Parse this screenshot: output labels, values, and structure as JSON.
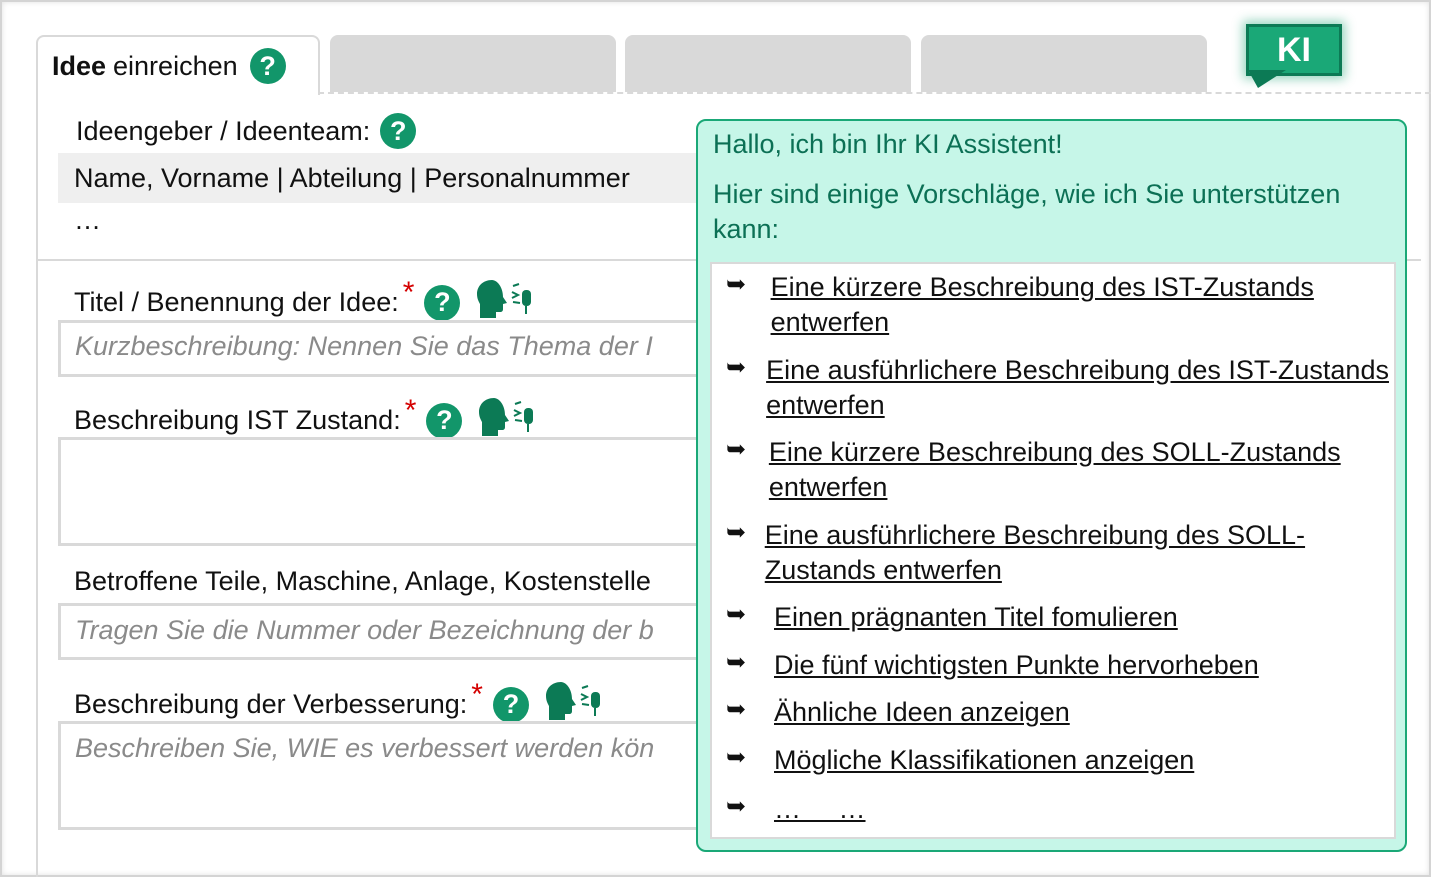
{
  "tabs": {
    "active_bold": "Idee",
    "active_rest": "einreichen",
    "inactive": [
      "",
      "",
      ""
    ]
  },
  "ki_badge": "KI",
  "form": {
    "ideengeber_label": "Ideengeber / Ideenteam:",
    "ideengeber_value": "Name, Vorname | Abteilung | Personalnummer",
    "ideengeber_more": "…",
    "titel_label": "Titel / Benennung der Idee:",
    "titel_placeholder": "Kurzbeschreibung: Nennen Sie das Thema der I",
    "ist_label": "Beschreibung IST Zustand:",
    "teile_label": "Betroffene Teile, Maschine, Anlage, Kostenstelle",
    "teile_placeholder": "Tragen Sie die Nummer oder Bezeichnung der b",
    "verbesserung_label": "Beschreibung der Verbesserung:",
    "verbesserung_placeholder": "Beschreiben Sie, WIE es verbessert werden kön",
    "required_mark": "*",
    "help_glyph": "?"
  },
  "assistant": {
    "greeting": "Hallo, ich bin Ihr KI Assistent!",
    "intro": "Hier sind einige Vorschläge, wie ich Sie unterstützen kann:",
    "bullet": "➥",
    "suggestions": [
      "Eine kürzere Beschreibung des IST-Zustands entwerfen",
      "Eine ausführlichere Beschreibung des IST-Zustands entwerfen",
      "Eine kürzere Beschreibung des SOLL-Zustands entwerfen",
      "Eine ausführlichere Beschreibung des SOLL-Zustands entwerfen",
      "Einen prägnanten Titel fomulieren",
      "Die fünf wichtigsten Punkte hervorheben",
      "Ähnliche Ideen anzeigen",
      "Mögliche Klassifikationen anzeigen",
      "…     …"
    ]
  },
  "colors": {
    "accent_green": "#12966a",
    "assistant_bg": "#c6f6e8",
    "assistant_text": "#0c7055",
    "required_red": "#d40000"
  },
  "icons": [
    "help-icon",
    "speech-to-text-icon",
    "arrow-bullet-icon",
    "ki-chat-icon"
  ]
}
